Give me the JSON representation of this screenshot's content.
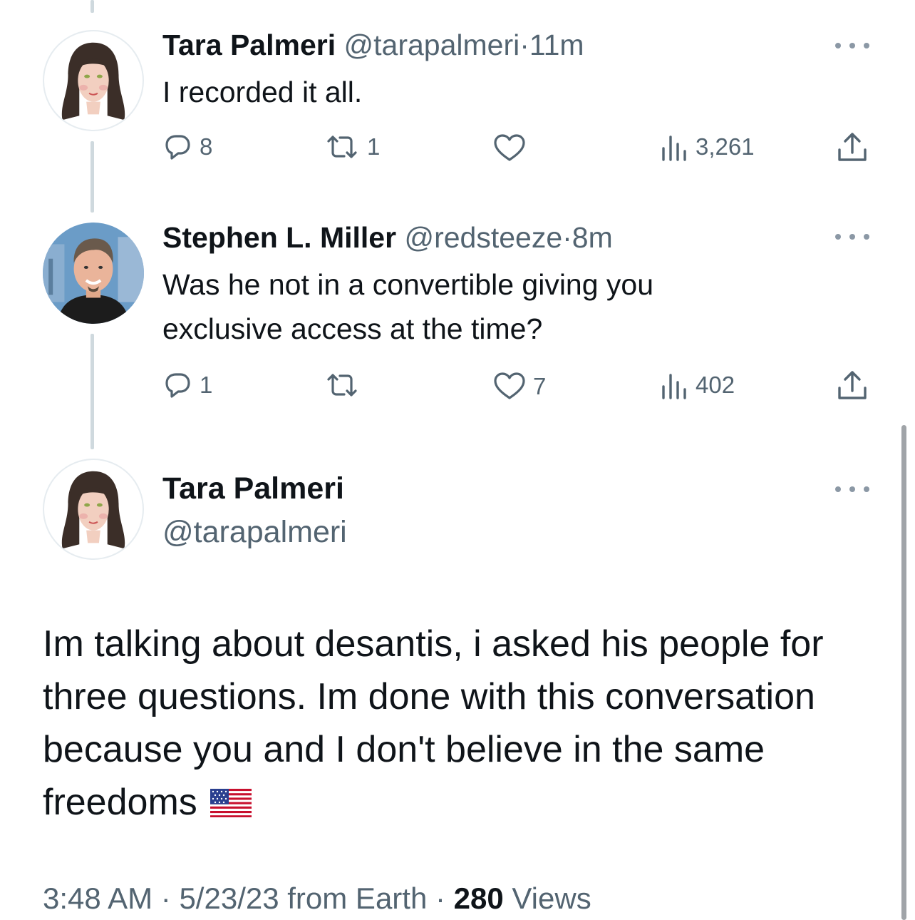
{
  "tweets": [
    {
      "name": "Tara Palmeri",
      "handle": "@tarapalmeri",
      "time": "11m",
      "text": "I recorded it all.",
      "replies": "8",
      "retweets": "1",
      "likes": "",
      "views": "3,261"
    },
    {
      "name": "Stephen L. Miller",
      "handle": "@redsteeze",
      "time": "8m",
      "text_lines": [
        "Was he not in a convertible giving you",
        "exclusive access at the time?"
      ],
      "replies": "1",
      "retweets": "",
      "likes": "7",
      "views": "402"
    }
  ],
  "detail": {
    "name": "Tara Palmeri",
    "handle": "@tarapalmeri",
    "text_lines": [
      "Im talking about desantis, i asked his people for",
      "three questions. Im done with this conversation",
      "because you and I don't believe in the same",
      "freedoms"
    ],
    "time": "3:48 AM",
    "date": "5/23/23",
    "source": "from Earth",
    "views_count": "280",
    "views_label": "Views"
  },
  "separator": "·",
  "icons": {
    "reply": "reply-icon",
    "retweet": "retweet-icon",
    "like": "heart-icon",
    "views": "views-icon",
    "share": "share-icon",
    "more": "more-icon",
    "flag": "us-flag-emoji"
  },
  "colors": {
    "text": "#0f1419",
    "secondary": "#536471",
    "thread_line": "#cfd9de"
  }
}
